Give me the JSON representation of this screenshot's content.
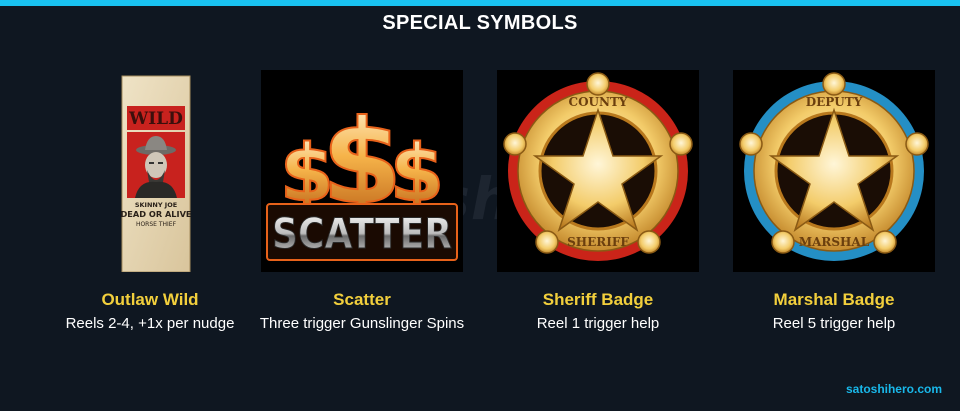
{
  "header": {
    "title": "SPECIAL SYMBOLS"
  },
  "watermark": {
    "text": "Satoshihero"
  },
  "symbols": [
    {
      "name": "Outlaw Wild",
      "description": "Reels 2-4, +1x per nudge",
      "icon": "wanted-poster-icon",
      "art_text": {
        "banner": "WILD",
        "line1": "SKINNY JOE",
        "line2": "DEAD OR ALIVE",
        "line3": "HORSE THIEF"
      }
    },
    {
      "name": "Scatter",
      "description": "Three trigger Gunslinger Spins",
      "icon": "dollar-scatter-icon",
      "art_text": {
        "main": "SCATTER"
      }
    },
    {
      "name": "Sheriff Badge",
      "description": "Reel 1 trigger help",
      "icon": "sheriff-badge-icon",
      "art_text": {
        "top": "COUNTY",
        "bottom": "SHERIFF"
      }
    },
    {
      "name": "Marshal Badge",
      "description": "Reel 5 trigger help",
      "icon": "marshal-badge-icon",
      "art_text": {
        "top": "DEPUTY",
        "bottom": "MARSHAL"
      }
    }
  ],
  "footer": {
    "credit": "satoshihero.com"
  },
  "colors": {
    "accent_bar": "#19c2f0",
    "symbol_name": "#f2cf3c",
    "background": "#0f1721",
    "credit": "#19b8ea"
  }
}
